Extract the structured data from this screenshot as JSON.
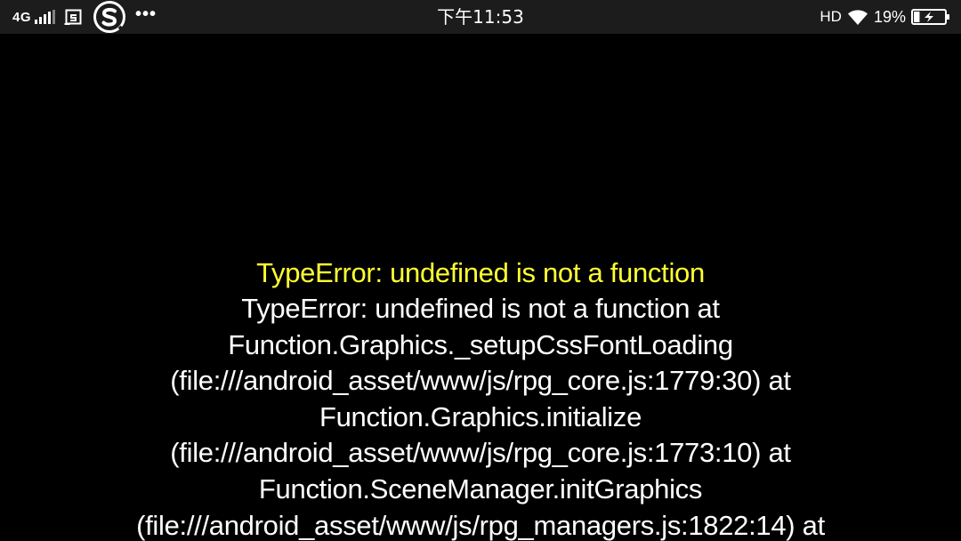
{
  "status_bar": {
    "network": "4G",
    "time": "下午11:53",
    "hd": "HD",
    "battery_percent": "19%",
    "battery_level": 0.19,
    "icons": [
      "signal-icon",
      "screenshot-app-icon",
      "sogou-icon",
      "more-dots-icon",
      "wifi-icon",
      "battery-charging-icon"
    ]
  },
  "error": {
    "title": "TypeError: undefined is not a function",
    "lines": [
      "TypeError: undefined is not a function at",
      "Function.Graphics._setupCssFontLoading",
      "(file:///android_asset/www/js/rpg_core.js:1779:30) at",
      "Function.Graphics.initialize",
      "(file:///android_asset/www/js/rpg_core.js:1773:10) at",
      "Function.SceneManager.initGraphics",
      "(file:///android_asset/www/js/rpg_managers.js:1822:14) at"
    ]
  },
  "colors": {
    "background": "#000000",
    "status_bar": "#1c1c1c",
    "error_title": "#ffff33",
    "error_text": "#ffffff"
  }
}
